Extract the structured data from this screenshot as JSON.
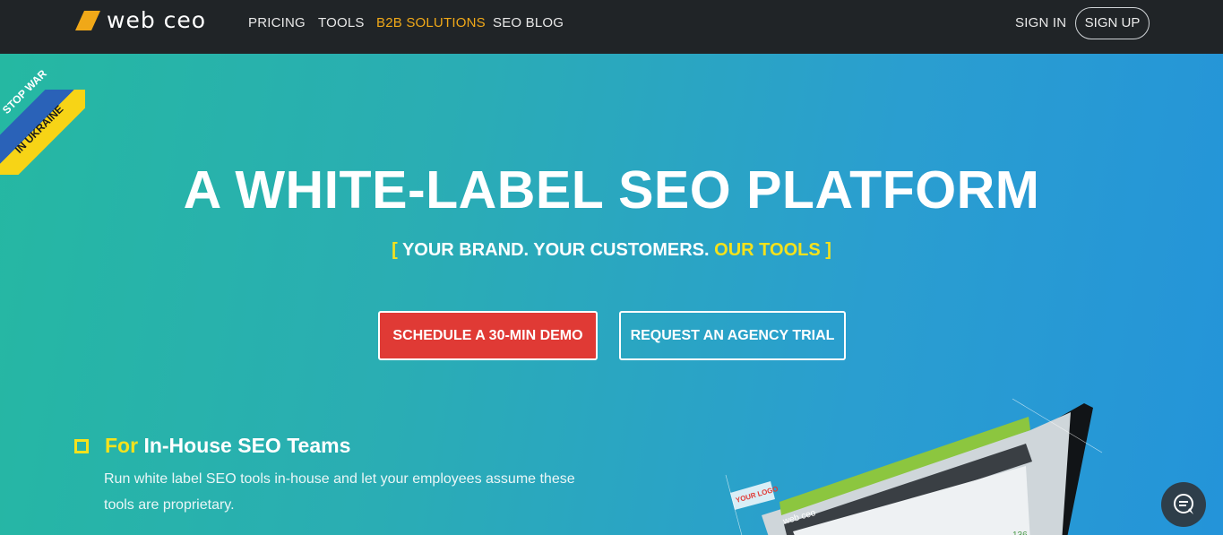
{
  "nav": {
    "logo_text": "web ceo",
    "links": [
      "PRICING",
      "TOOLS",
      "B2B SOLUTIONS",
      "SEO BLOG"
    ],
    "active_link": "B2B SOLUTIONS",
    "sign_in": "SIGN IN",
    "sign_up": "SIGN UP"
  },
  "ribbon": {
    "line1": "STOP WAR",
    "line2": "IN UKRAINE"
  },
  "hero": {
    "headline": "A WHITE-LABEL SEO PLATFORM",
    "tagline_bracket_open": "[",
    "tagline_main": "YOUR BRAND. YOUR CUSTOMERS.",
    "tagline_highlight": "OUR TOOLS",
    "tagline_bracket_close": "]",
    "primary_button": "SCHEDULE A 30-MIN DEMO",
    "secondary_button": "REQUEST AN AGENCY TRIAL"
  },
  "feature": {
    "title_prefix": "For",
    "title_rest": "In-House SEO Teams",
    "description": "Run white label SEO tools in-house and let your employees assume these tools are proprietary."
  },
  "mockup": {
    "logo_label": "YOUR LOGO",
    "app_name": "web ceo",
    "number": "136"
  },
  "colors": {
    "nav_bg": "#202427",
    "accent_orange": "#f0a818",
    "accent_yellow": "#f5e21c",
    "cta_red": "#e03a35",
    "hero_start": "#25b8a2",
    "hero_end": "#2494d9"
  },
  "icons": {
    "logo": "webceo-logo-icon",
    "chat": "chat-bubble-icon"
  }
}
